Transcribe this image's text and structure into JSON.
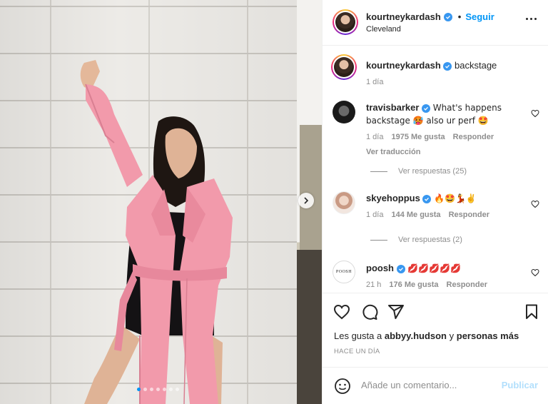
{
  "post": {
    "username": "kourtneykardash",
    "follow_label": "Seguir",
    "separator": "•",
    "location": "Cleveland"
  },
  "caption": {
    "username": "kourtneykardash",
    "text": "backstage",
    "time": "1 día"
  },
  "comments": [
    {
      "username": "travisbarker",
      "text": "What's happens backstage 🥵 also ur perf 🤩",
      "time": "1 día",
      "likes": "1975 Me gusta",
      "reply": "Responder",
      "translate": "Ver traducción",
      "view_replies": "Ver respuestas (25)"
    },
    {
      "username": "skyehoppus",
      "text": "🔥🤩💃✌️",
      "time": "1 día",
      "likes": "144 Me gusta",
      "reply": "Responder",
      "view_replies": "Ver respuestas (2)"
    },
    {
      "username": "poosh",
      "text": "💋💋💋💋💋",
      "time": "21 h",
      "likes": "176 Me gusta",
      "reply": "Responder",
      "avatar_text": "POOSH"
    }
  ],
  "likes": {
    "prefix": "Les gusta a",
    "user": "abbyy.hudson",
    "middle": "y",
    "others": "personas más"
  },
  "timestamp": "HACE UN DÍA",
  "add_comment": {
    "placeholder": "Añade un comentario...",
    "publish_label": "Publicar"
  },
  "carousel": {
    "total": 7,
    "active_index": 1
  },
  "colors": {
    "accent": "#0095f6",
    "verified": "#3897f0",
    "publish_disabled": "#b2dffc",
    "coat": "#f29aab"
  },
  "icons": [
    "heart-icon",
    "comment-icon",
    "share-icon",
    "bookmark-icon",
    "emoji-icon",
    "more-icon",
    "chevron-right-icon",
    "verified-icon"
  ]
}
